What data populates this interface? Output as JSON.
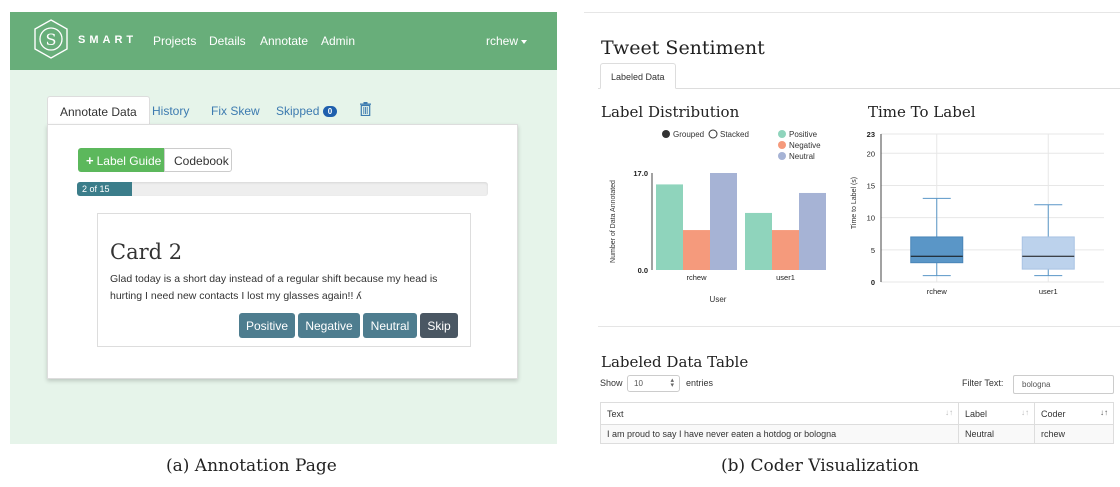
{
  "panel_a": {
    "navbar": {
      "brand": "SMART",
      "logo_letter": "S",
      "links": [
        "Projects",
        "Details",
        "Annotate",
        "Admin"
      ],
      "user": "rchew"
    },
    "tabs": [
      {
        "label": "Annotate Data",
        "active": true
      },
      {
        "label": "History",
        "active": false
      },
      {
        "label": "Fix Skew",
        "active": false
      },
      {
        "label": "Skipped",
        "active": false,
        "badge": "0"
      }
    ],
    "toolbar": {
      "label_guide": "Label Guide",
      "codebook": "Codebook"
    },
    "progress": {
      "text": "2 of 15",
      "fraction": 0.1333
    },
    "card": {
      "title": "Card 2",
      "text": "Glad today is a short day instead of a regular shift because my head is hurting I need new contacts I lost my glasses again!! ʎ",
      "buttons": [
        "Positive",
        "Negative",
        "Neutral",
        "Skip"
      ]
    }
  },
  "panel_b": {
    "title": "Tweet Sentiment",
    "tab": "Labeled Data",
    "label_distribution": {
      "heading": "Label Distribution",
      "toggle": [
        "Grouped",
        "Stacked"
      ]
    },
    "time_to_label": {
      "heading": "Time To Label"
    },
    "table": {
      "heading": "Labeled Data Table",
      "show": "Show",
      "show_value": "10",
      "entries": "entries",
      "filter_label": "Filter Text:",
      "filter_value": "bologna",
      "columns": [
        "Text",
        "Label",
        "Coder"
      ],
      "rows": [
        [
          "I am proud to say I have never eaten a hotdog or bologna",
          "Neutral",
          "rchew"
        ]
      ]
    }
  },
  "captions": [
    "(a) Annotation Page",
    "(b) Coder Visualization"
  ],
  "colors": {
    "navbar": "#68ae7a",
    "page_bg": "#e6f4ea",
    "positive": "#8fd4bc",
    "negative": "#f59a7c",
    "neutral": "#a6b3d5",
    "box_rchew": "#5a96c7",
    "box_user1": "#bcd2ec"
  },
  "chart_data": [
    {
      "type": "bar",
      "title": "Label Distribution",
      "xlabel": "User",
      "ylabel": "Number of Data Annotated",
      "categories": [
        "rchew",
        "user1"
      ],
      "series": [
        {
          "name": "Positive",
          "values": [
            15,
            10
          ]
        },
        {
          "name": "Negative",
          "values": [
            7,
            7
          ]
        },
        {
          "name": "Neutral",
          "values": [
            17,
            13.5
          ]
        }
      ],
      "ylim": [
        0,
        17
      ],
      "y_ticks": [
        "0.0",
        "17.0"
      ],
      "legend": "top-right"
    },
    {
      "type": "box",
      "title": "Time To Label",
      "ylabel": "Time to Label (s)",
      "categories": [
        "rchew",
        "user1"
      ],
      "boxes": [
        {
          "min": 1,
          "q1": 3,
          "median": 4,
          "q3": 7,
          "max": 13
        },
        {
          "min": 1,
          "q1": 2,
          "median": 4,
          "q3": 7,
          "max": 12
        }
      ],
      "ylim": [
        0,
        23
      ],
      "y_ticks": [
        0,
        5,
        10,
        15,
        20,
        23
      ],
      "grid": true
    }
  ]
}
